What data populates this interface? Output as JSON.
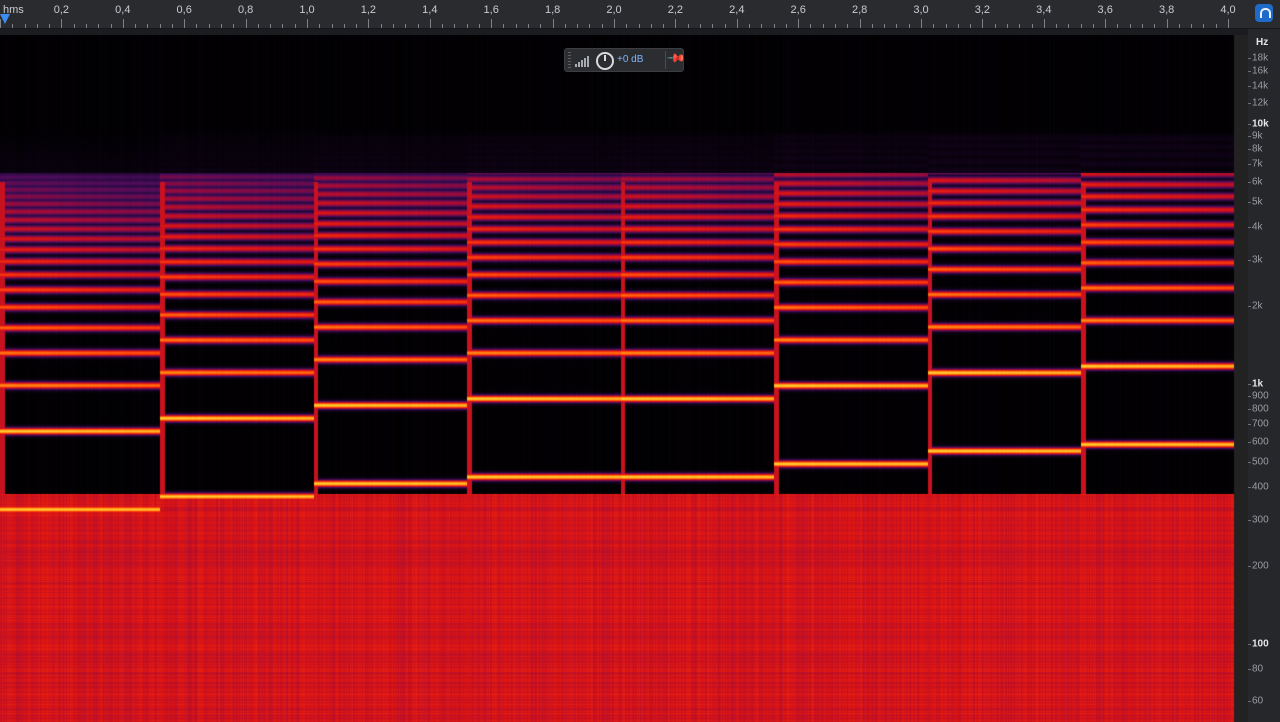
{
  "ruler": {
    "unit": "hms",
    "ticks": [
      "0,2",
      "0,4",
      "0,6",
      "0,8",
      "1,0",
      "1,2",
      "1,4",
      "1,6",
      "1,8",
      "2,0",
      "2,2",
      "2,4",
      "2,6",
      "2,8",
      "3,0",
      "3,2",
      "3,4",
      "3,6",
      "3,8",
      "4,0"
    ],
    "tick_seconds": [
      0.2,
      0.4,
      0.6,
      0.8,
      1.0,
      1.2,
      1.4,
      1.6,
      1.8,
      2.0,
      2.2,
      2.4,
      2.6,
      2.8,
      3.0,
      3.2,
      3.4,
      3.6,
      3.8,
      4.0
    ],
    "range_seconds": [
      0,
      4.0
    ]
  },
  "gain_hud": {
    "gain_label": "+0 dB",
    "knob_icon": "knob-icon",
    "meter_icon": "level-meter-icon",
    "pin_icon": "pin-icon"
  },
  "freq_scale": {
    "unit": "Hz",
    "labels": [
      {
        "text": "18k",
        "hz": 18000,
        "major": false
      },
      {
        "text": "16k",
        "hz": 16000,
        "major": false
      },
      {
        "text": "14k",
        "hz": 14000,
        "major": false
      },
      {
        "text": "12k",
        "hz": 12000,
        "major": false
      },
      {
        "text": "10k",
        "hz": 10000,
        "major": true
      },
      {
        "text": "9k",
        "hz": 9000,
        "major": false
      },
      {
        "text": "8k",
        "hz": 8000,
        "major": false
      },
      {
        "text": "7k",
        "hz": 7000,
        "major": false
      },
      {
        "text": "6k",
        "hz": 6000,
        "major": false
      },
      {
        "text": "5k",
        "hz": 5000,
        "major": false
      },
      {
        "text": "4k",
        "hz": 4000,
        "major": false
      },
      {
        "text": "3k",
        "hz": 3000,
        "major": false
      },
      {
        "text": "2k",
        "hz": 2000,
        "major": false
      },
      {
        "text": "1k",
        "hz": 1000,
        "major": true
      },
      {
        "text": "900",
        "hz": 900,
        "major": false
      },
      {
        "text": "800",
        "hz": 800,
        "major": false
      },
      {
        "text": "700",
        "hz": 700,
        "major": false
      },
      {
        "text": "600",
        "hz": 600,
        "major": false
      },
      {
        "text": "500",
        "hz": 500,
        "major": false
      },
      {
        "text": "400",
        "hz": 400,
        "major": false
      },
      {
        "text": "300",
        "hz": 300,
        "major": false
      },
      {
        "text": "200",
        "hz": 200,
        "major": false
      },
      {
        "text": "100",
        "hz": 100,
        "major": true
      },
      {
        "text": "80",
        "hz": 80,
        "major": false
      },
      {
        "text": "60",
        "hz": 60,
        "major": false
      }
    ]
  },
  "spectrogram": {
    "colormap": [
      "#000000",
      "#2a0a3a",
      "#6a0f5a",
      "#c0102a",
      "#ff2a10",
      "#ff8a10",
      "#ffe030"
    ],
    "notes": [
      {
        "start_s": 0.0,
        "end_s": 0.52,
        "fundamental_hz": 330
      },
      {
        "start_s": 0.52,
        "end_s": 1.02,
        "fundamental_hz": 370
      },
      {
        "start_s": 1.02,
        "end_s": 1.52,
        "fundamental_hz": 415
      },
      {
        "start_s": 1.52,
        "end_s": 2.02,
        "fundamental_hz": 440
      },
      {
        "start_s": 2.02,
        "end_s": 2.52,
        "fundamental_hz": 440
      },
      {
        "start_s": 2.52,
        "end_s": 3.02,
        "fundamental_hz": 494
      },
      {
        "start_s": 3.02,
        "end_s": 3.52,
        "fundamental_hz": 554
      },
      {
        "start_s": 3.52,
        "end_s": 4.0,
        "fundamental_hz": 587
      }
    ]
  }
}
